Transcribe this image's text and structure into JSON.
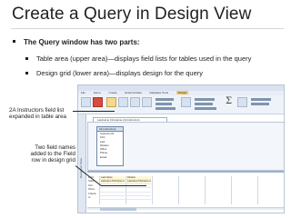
{
  "slide": {
    "title": "Create a Query in Design View",
    "bullets": [
      {
        "level": 1,
        "text": "The Query window has two parts:"
      },
      {
        "level": 2,
        "text": "Table area (upper area)—displays field lists for tables used in the query"
      },
      {
        "level": 2,
        "text": "Design grid (lower area)—displays design for the query"
      }
    ],
    "callouts": [
      {
        "lines": [
          "2A Instructors field list",
          "expanded in table area"
        ]
      },
      {
        "lines": [
          "Two field names",
          "added to the Field",
          "row in design grid"
        ]
      }
    ]
  },
  "access_window": {
    "ribbon_tabs": [
      "File",
      "Home",
      "Create",
      "External Data",
      "Database Tools",
      "Design"
    ],
    "context_tab": "Query Tools",
    "ribbon_icons": [
      "view-icon",
      "run-icon",
      "select-icon",
      "make-table-icon",
      "append-icon",
      "update-icon",
      "crosstab-icon",
      "delete-icon",
      "show-table-icon",
      "totals-icon",
      "parameters-icon"
    ],
    "nav_pane_label": "Navigation Pane",
    "document_tab": "Lastname Firstname 2A Instructors",
    "field_list": {
      "title": "2A Instructors",
      "fields": [
        "Instructor ID",
        "First",
        "Last",
        "Division",
        "Office",
        "Phone",
        "Email"
      ]
    },
    "grid_row_labels": [
      "Field:",
      "Table:",
      "Sort:",
      "Show:",
      "Criteria:",
      "or:"
    ],
    "grid_columns": [
      {
        "field": "Last Name",
        "table": "Lastname Firstname 2A"
      },
      {
        "field": "Division",
        "table": "Lastname Firstname 2A"
      }
    ]
  },
  "colors": {
    "ribbon_bg": "#eef3fa",
    "context_tab": "#f4c76b",
    "run_button": "#d94b3a",
    "callout_line": "#222222"
  }
}
